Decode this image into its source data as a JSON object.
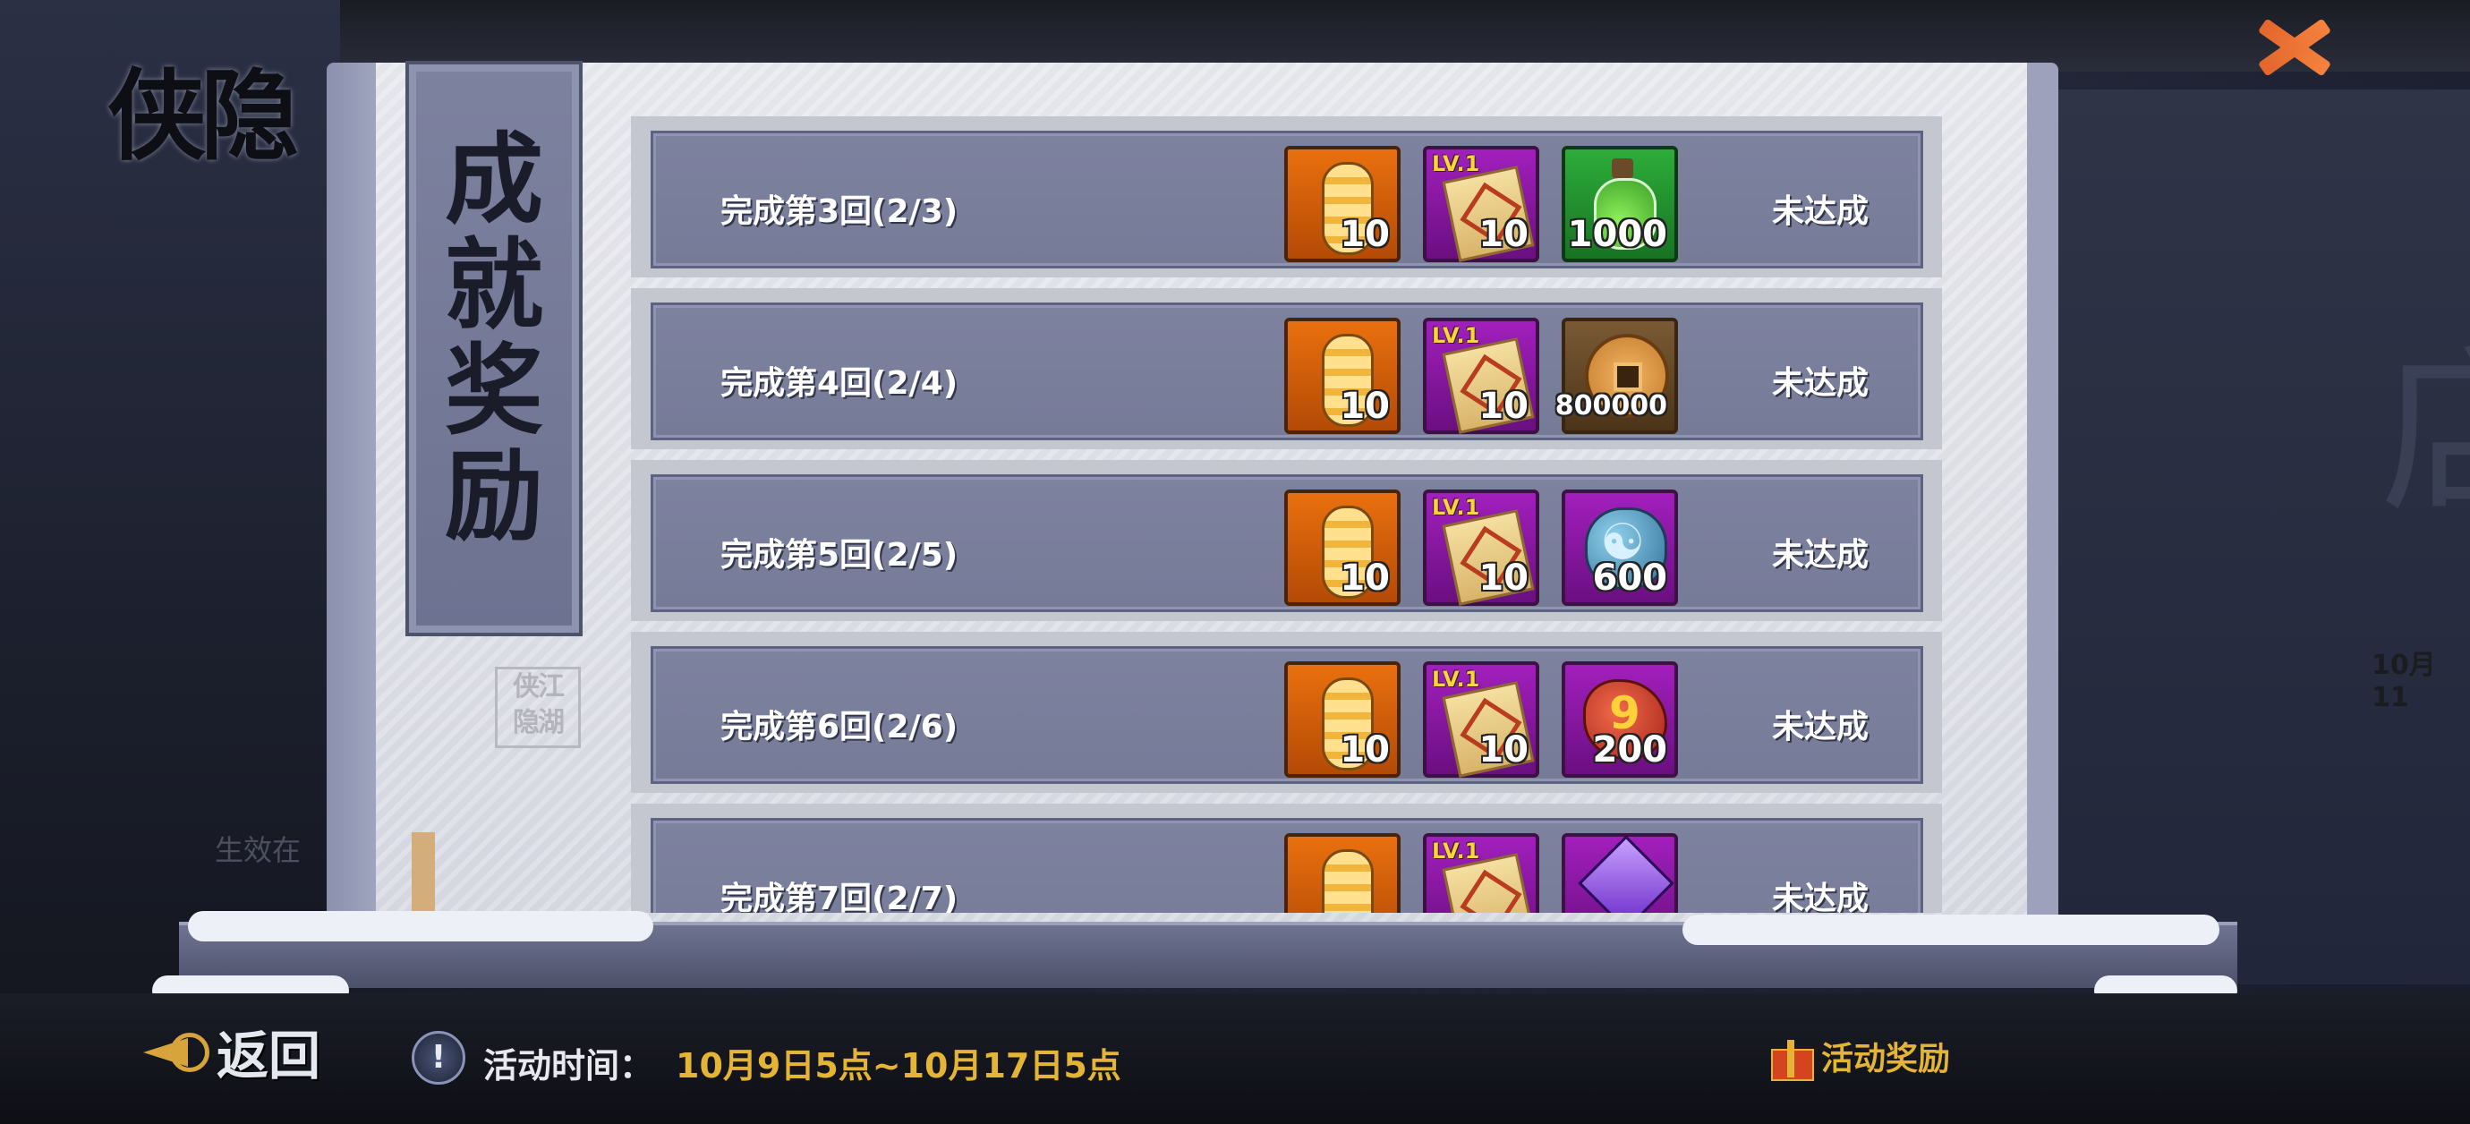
{
  "header": {
    "logo_text": "侠隐"
  },
  "panel": {
    "banner_title": "成就奖励",
    "seal_text": "侠江 隐湖"
  },
  "background": {
    "date_partial": "10月11",
    "side_text": "生效在"
  },
  "rows": [
    {
      "label": "完成第3回(2/3)",
      "status": "未达成",
      "rewards": [
        {
          "icon": "coupon-icon",
          "qty": "10"
        },
        {
          "icon": "scroll-icon",
          "level": "LV.1",
          "qty": "10"
        },
        {
          "icon": "potion-bottle-icon",
          "qty": "1000"
        }
      ]
    },
    {
      "label": "完成第4回(2/4)",
      "status": "未达成",
      "rewards": [
        {
          "icon": "coupon-icon",
          "qty": "10"
        },
        {
          "icon": "scroll-icon",
          "level": "LV.1",
          "qty": "10"
        },
        {
          "icon": "copper-coin-icon",
          "qty": "800000"
        }
      ]
    },
    {
      "label": "完成第5回(2/5)",
      "status": "未达成",
      "rewards": [
        {
          "icon": "coupon-icon",
          "qty": "10"
        },
        {
          "icon": "scroll-icon",
          "level": "LV.1",
          "qty": "10"
        },
        {
          "icon": "yinyang-orb-icon",
          "qty": "600"
        }
      ]
    },
    {
      "label": "完成第6回(2/6)",
      "status": "未达成",
      "rewards": [
        {
          "icon": "coupon-icon",
          "qty": "10"
        },
        {
          "icon": "scroll-icon",
          "level": "LV.1",
          "qty": "10"
        },
        {
          "icon": "red-stone-icon",
          "qty": "200"
        }
      ]
    },
    {
      "label": "完成第7回(2/7)",
      "status": "未达成",
      "rewards": [
        {
          "icon": "coupon-icon",
          "qty": ""
        },
        {
          "icon": "scroll-icon",
          "level": "LV.1",
          "qty": ""
        },
        {
          "icon": "purple-gem-icon",
          "qty": ""
        }
      ]
    }
  ],
  "footer": {
    "back_label": "返回",
    "time_label": "活动时间：",
    "time_value": "10月9日5点~10月17日5点",
    "reward_label": "活动奖励"
  },
  "colors": {
    "accent_gold": "#e3b435",
    "row_bg": "#7d829f",
    "close_orange": "#f5823e"
  }
}
